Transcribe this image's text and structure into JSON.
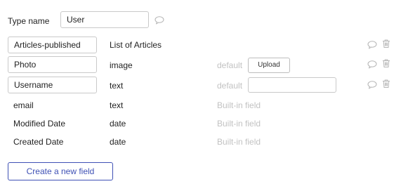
{
  "type_header": {
    "label": "Type name",
    "value": "User",
    "comment_icon": "comment-icon"
  },
  "fields": [
    {
      "name": "Articles-published",
      "type": "List of Articles",
      "editable_name": true,
      "comment_icon": "comment-icon",
      "delete_icon": "trash-icon"
    },
    {
      "name": "Photo",
      "type": "image",
      "default_label": "default",
      "upload_label": "Upload",
      "editable_name": true,
      "comment_icon": "comment-icon",
      "delete_icon": "trash-icon"
    },
    {
      "name": "Username",
      "type": "text",
      "default_label": "default",
      "default_value": "",
      "editable_name": true,
      "comment_icon": "comment-icon",
      "delete_icon": "trash-icon"
    },
    {
      "name": "email",
      "type": "text",
      "builtin_label": "Built-in field",
      "editable_name": false
    },
    {
      "name": "Modified Date",
      "type": "date",
      "builtin_label": "Built-in field",
      "editable_name": false
    },
    {
      "name": "Created Date",
      "type": "date",
      "builtin_label": "Built-in field",
      "editable_name": false
    }
  ],
  "create_button": {
    "label": "Create a new field"
  },
  "colors": {
    "accent": "#3f51b5",
    "muted_text": "#c2c2c2",
    "border": "#c9c9c9",
    "icon": "#b5b5b5"
  }
}
